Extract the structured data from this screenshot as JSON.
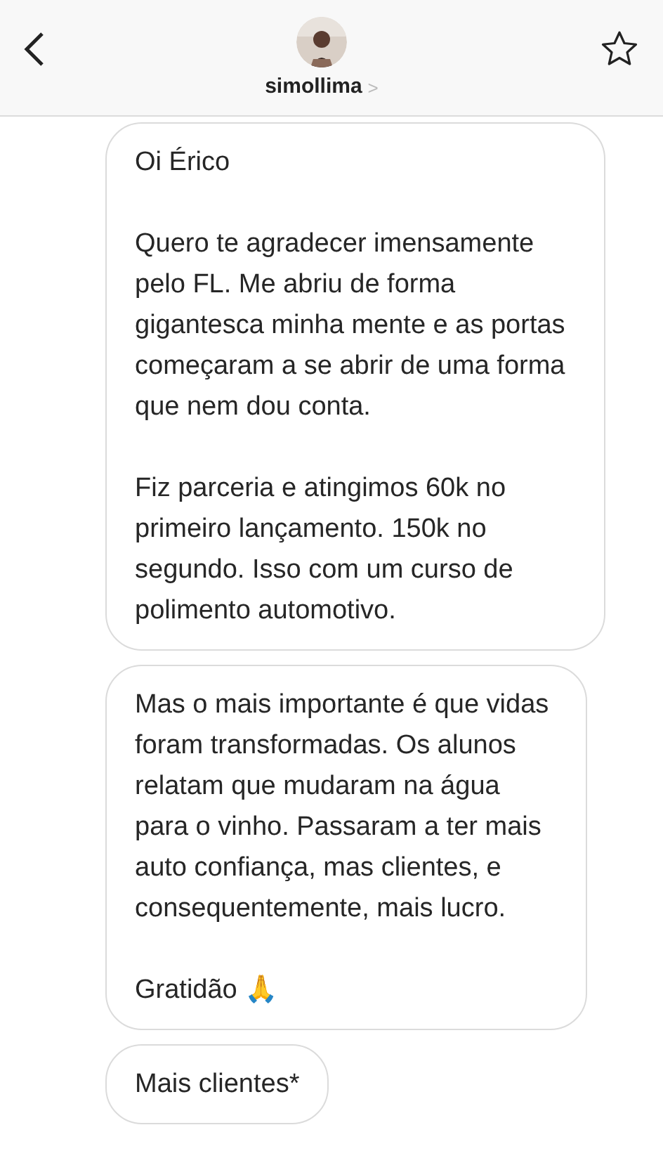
{
  "header": {
    "username": "simollima",
    "chevron": ">"
  },
  "messages": [
    {
      "paragraphs": [
        "Oi Érico",
        "Quero te agradecer imensamente pelo FL. Me abriu de forma gigantesca minha mente e as portas começaram a se abrir de uma forma que nem dou conta.",
        "Fiz parceria e atingimos 60k no primeiro lançamento. 150k no segundo. Isso com um curso de polimento automotivo."
      ]
    },
    {
      "paragraphs": [
        "Mas o mais importante é que vidas foram transformadas. Os alunos relatam que mudaram na água para o vinho. Passaram a ter mais auto confiança, mas clientes, e consequentemente, mais lucro.",
        "Gratidão 🙏"
      ]
    },
    {
      "paragraphs": [
        "Mais clientes*"
      ]
    }
  ]
}
